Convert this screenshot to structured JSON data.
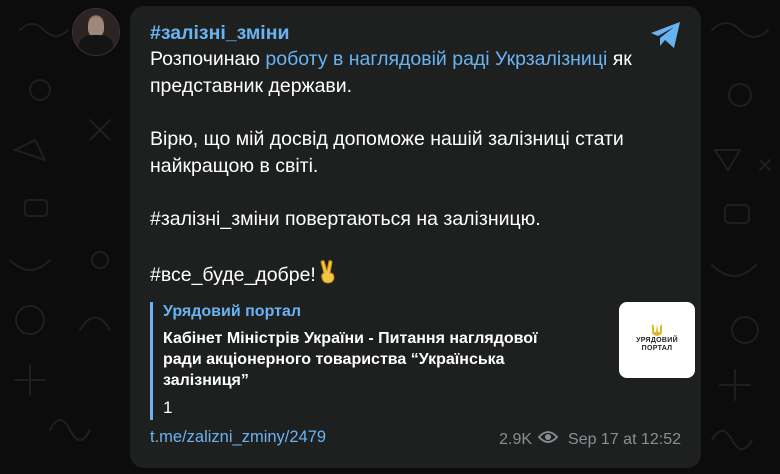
{
  "channel": {
    "hashtag_title": "#залізні_зміни"
  },
  "message": {
    "p1_prefix": "Розпочинаю ",
    "p1_link": "роботу в наглядовій раді Укрзалізниці",
    "p1_suffix": " як представник держави.",
    "p2": "Вірю, що мій досвід допоможе нашій залізниці стати найкращою в світі.",
    "p3": "#залізні_зміни повертаються на залізницю.",
    "p4": "#все_буде_добре!"
  },
  "preview": {
    "site_name": "Урядовий портал",
    "title": "Кабінет Міністрів України - Питання наглядової ради акціонерного товариства “Українська залізниця”",
    "description": "1",
    "thumb_line1": "УРЯДОВИЙ",
    "thumb_line2": "ПОРТАЛ"
  },
  "footer": {
    "post_link": "t.me/zalizni_zminy/2479",
    "views": "2.9K",
    "date": "Sep 17 at 12:52"
  },
  "icons": {
    "share": "telegram-share-icon",
    "views": "eye-icon",
    "emoji": "victory-hand-icon"
  },
  "colors": {
    "accent": "#6ab3f3",
    "bubble": "#1e2020",
    "background": "#0c0c0c"
  }
}
